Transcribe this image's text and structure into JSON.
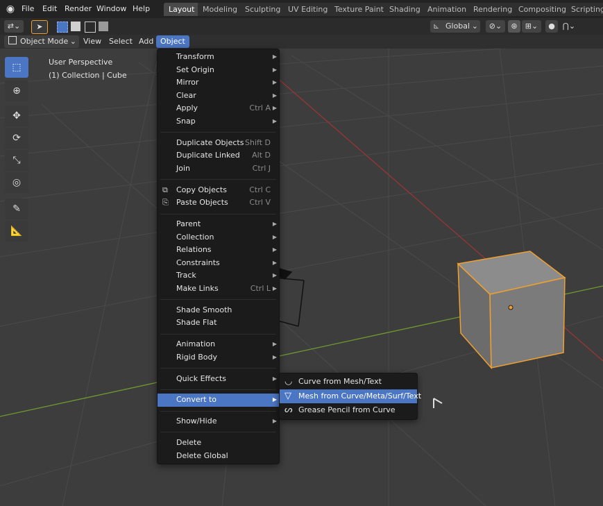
{
  "topbar": {
    "menus": [
      "File",
      "Edit",
      "Render",
      "Window",
      "Help"
    ],
    "workspaces": [
      "Layout",
      "Modeling",
      "Sculpting",
      "UV Editing",
      "Texture Paint",
      "Shading",
      "Animation",
      "Rendering",
      "Compositing",
      "Scripting"
    ],
    "active_workspace": "Layout"
  },
  "toolheader": {
    "orientation": "Global"
  },
  "viewport_header": {
    "mode": "Object Mode",
    "menus": [
      "View",
      "Select",
      "Add",
      "Object"
    ],
    "active_menu": "Object"
  },
  "viewport_info": {
    "perspective": "User Perspective",
    "collection": "(1) Collection | Cube"
  },
  "object_menu": {
    "groups": [
      [
        {
          "label": "Transform",
          "shortcut": "",
          "submenu": true
        },
        {
          "label": "Set Origin",
          "shortcut": "",
          "submenu": true
        },
        {
          "label": "Mirror",
          "shortcut": "",
          "submenu": true
        },
        {
          "label": "Clear",
          "shortcut": "",
          "submenu": true
        },
        {
          "label": "Apply",
          "shortcut": "Ctrl A",
          "submenu": true
        },
        {
          "label": "Snap",
          "shortcut": "",
          "submenu": true
        }
      ],
      [
        {
          "label": "Duplicate Objects",
          "shortcut": "Shift D",
          "submenu": false
        },
        {
          "label": "Duplicate Linked",
          "shortcut": "Alt D",
          "submenu": false
        },
        {
          "label": "Join",
          "shortcut": "Ctrl J",
          "submenu": false
        }
      ],
      [
        {
          "label": "Copy Objects",
          "shortcut": "Ctrl C",
          "submenu": false,
          "icon": "copy-icon"
        },
        {
          "label": "Paste Objects",
          "shortcut": "Ctrl V",
          "submenu": false,
          "icon": "paste-icon"
        }
      ],
      [
        {
          "label": "Parent",
          "shortcut": "",
          "submenu": true
        },
        {
          "label": "Collection",
          "shortcut": "",
          "submenu": true
        },
        {
          "label": "Relations",
          "shortcut": "",
          "submenu": true
        },
        {
          "label": "Constraints",
          "shortcut": "",
          "submenu": true
        },
        {
          "label": "Track",
          "shortcut": "",
          "submenu": true
        },
        {
          "label": "Make Links",
          "shortcut": "Ctrl L",
          "submenu": true
        }
      ],
      [
        {
          "label": "Shade Smooth",
          "shortcut": "",
          "submenu": false
        },
        {
          "label": "Shade Flat",
          "shortcut": "",
          "submenu": false
        }
      ],
      [
        {
          "label": "Animation",
          "shortcut": "",
          "submenu": true
        },
        {
          "label": "Rigid Body",
          "shortcut": "",
          "submenu": true
        }
      ],
      [
        {
          "label": "Quick Effects",
          "shortcut": "",
          "submenu": true
        }
      ],
      [
        {
          "label": "Convert to",
          "shortcut": "",
          "submenu": true,
          "highlighted": true
        }
      ],
      [
        {
          "label": "Show/Hide",
          "shortcut": "",
          "submenu": true
        }
      ],
      [
        {
          "label": "Delete",
          "shortcut": "",
          "submenu": false
        },
        {
          "label": "Delete Global",
          "shortcut": "",
          "submenu": false
        }
      ]
    ]
  },
  "convert_submenu": {
    "items": [
      {
        "label": "Curve from Mesh/Text",
        "icon": "curve-icon",
        "highlighted": false
      },
      {
        "label": "Mesh from Curve/Meta/Surf/Text",
        "icon": "mesh-icon",
        "highlighted": true
      },
      {
        "label": "Grease Pencil from Curve",
        "icon": "grease-pencil-icon",
        "highlighted": false
      }
    ]
  },
  "colors": {
    "accent": "#4b76c4",
    "selection_outline": "#f0a030",
    "grid_x_axis": "#a03838",
    "grid_y_axis": "#6a9a2a"
  }
}
